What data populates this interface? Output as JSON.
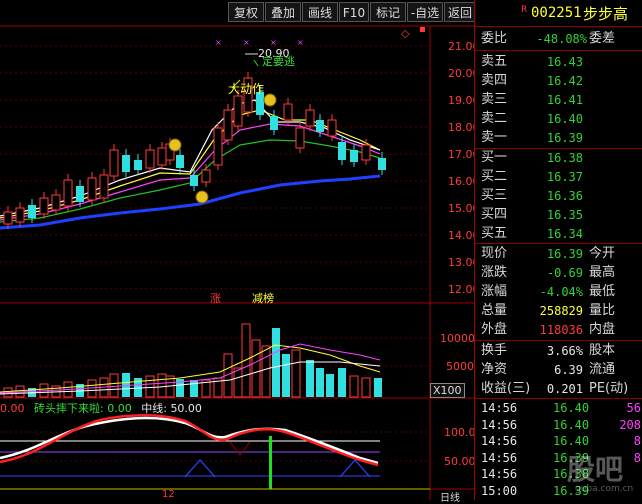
{
  "toolbar": {
    "buttons": [
      "复权",
      "叠加",
      "画线",
      "F10",
      "标记",
      "-自选",
      "返回"
    ],
    "r_badge": "R",
    "code": "002251",
    "name": "步步高"
  },
  "price_axis": [
    "21.00",
    "20.00",
    "19.00",
    "18.00",
    "17.00",
    "16.00",
    "15.00",
    "14.00",
    "13.00",
    "12.00"
  ],
  "volume_axis": [
    "10000",
    "5000"
  ],
  "volume_unit": "X100",
  "indicator_axis": [
    "100.0",
    "50.00"
  ],
  "annotations": {
    "high_price": "20.90",
    "sell_signal": "定要逃",
    "big_move": "大动作",
    "bar_label_up": "涨",
    "bar_label_list": "减榜"
  },
  "indicator_legend": {
    "item1_label": "砖头摔下来啦:",
    "item1_value": "0.00",
    "item0_value": "0.00",
    "mid_label": "中线:",
    "mid_value": "50.00"
  },
  "bottom_labels": [
    "12",
    "日线"
  ],
  "panel": {
    "weibi_label": "委比",
    "weibi_value": "-48.08%",
    "weicha_label": "委差",
    "asks": [
      {
        "label": "卖五",
        "price": "16.43"
      },
      {
        "label": "卖四",
        "price": "16.42"
      },
      {
        "label": "卖三",
        "price": "16.41"
      },
      {
        "label": "卖二",
        "price": "16.40"
      },
      {
        "label": "卖一",
        "price": "16.39"
      }
    ],
    "bids": [
      {
        "label": "买一",
        "price": "16.38"
      },
      {
        "label": "买二",
        "price": "16.37"
      },
      {
        "label": "买三",
        "price": "16.36"
      },
      {
        "label": "买四",
        "price": "16.35"
      },
      {
        "label": "买五",
        "price": "16.34"
      }
    ],
    "stats": [
      {
        "label": "现价",
        "value": "16.39",
        "label2": "今开",
        "color": "green"
      },
      {
        "label": "涨跌",
        "value": "-0.69",
        "label2": "最高",
        "color": "green"
      },
      {
        "label": "涨幅",
        "value": "-4.04%",
        "label2": "最低",
        "color": "green"
      },
      {
        "label": "总量",
        "value": "258829",
        "label2": "量比",
        "color": "yellow"
      },
      {
        "label": "外盘",
        "value": "118036",
        "label2": "内盘",
        "color": "red"
      }
    ],
    "stats2": [
      {
        "label": "换手",
        "value": "3.66%",
        "label2": "股本"
      },
      {
        "label": "净资",
        "value": "6.39",
        "label2": "流通"
      },
      {
        "label": "收益(三)",
        "value": "0.201",
        "label2": "PE(动)"
      }
    ],
    "ticks": [
      {
        "time": "14:56",
        "price": "16.40",
        "vol": "56"
      },
      {
        "time": "14:56",
        "price": "16.40",
        "vol": "208"
      },
      {
        "time": "14:56",
        "price": "16.40",
        "vol": "8"
      },
      {
        "time": "14:56",
        "price": "16.39",
        "vol": "8"
      },
      {
        "time": "14:56",
        "price": "16.38",
        "vol": ""
      },
      {
        "time": "15:00",
        "price": "16.39",
        "vol": ""
      }
    ]
  },
  "watermark": "股吧",
  "watermark_url": "guba.com.cn",
  "colors": {
    "up": "#ff3b3b",
    "down": "#30e0e0",
    "panel_border": "#8a0000",
    "ma_blue": "#2040ff"
  }
}
